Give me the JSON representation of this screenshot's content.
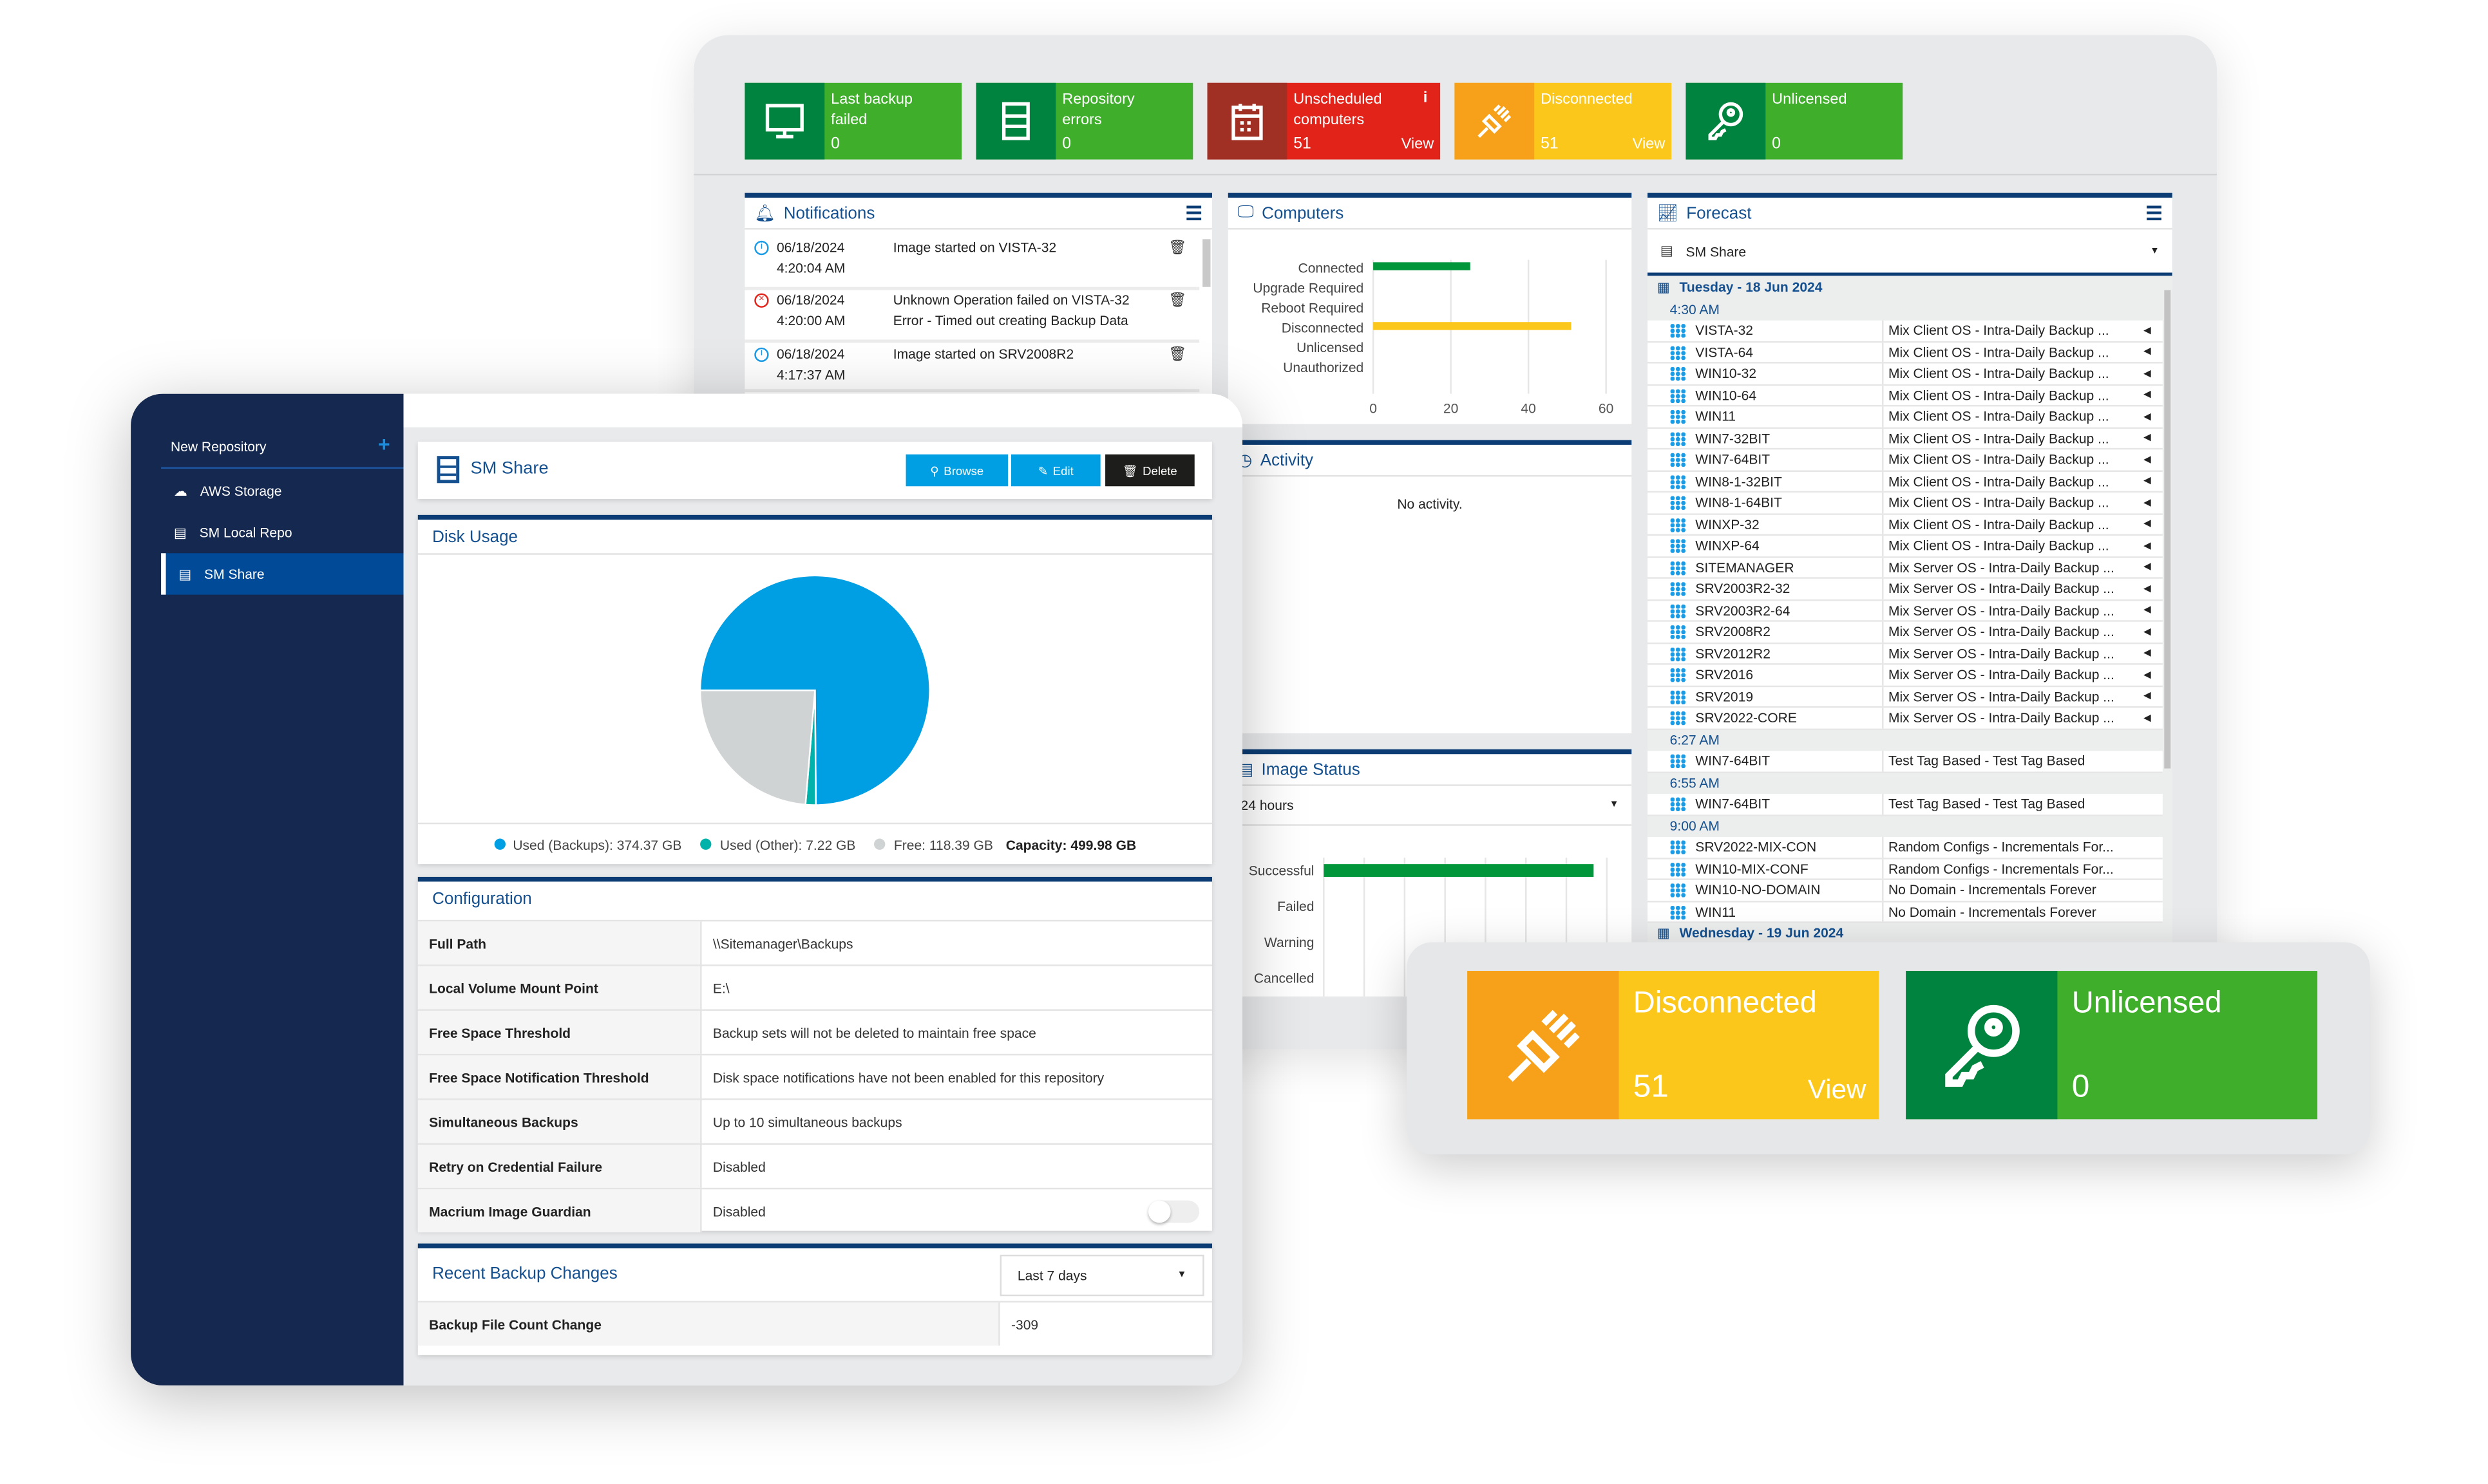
{
  "tiles": [
    {
      "title": "Last backup failed",
      "value": "0",
      "icon": "monitor-icon",
      "dark": "#00833e",
      "light": "#3fae2a"
    },
    {
      "title": "Repository errors",
      "value": "0",
      "icon": "server-icon",
      "dark": "#00833e",
      "light": "#3fae2a"
    },
    {
      "title": "Unscheduled computers",
      "value": "51",
      "view": "View",
      "icon": "calendar-icon",
      "info": "i",
      "dark": "#a03024",
      "light": "#e2231a"
    },
    {
      "title": "Disconnected",
      "value": "51",
      "view": "View",
      "icon": "plug-icon",
      "dark": "#f7a11a",
      "light": "#fbc71b"
    },
    {
      "title": "Unlicensed",
      "value": "0",
      "icon": "key-icon",
      "dark": "#00833e",
      "light": "#3fae2a"
    }
  ],
  "notifications": {
    "title": "Notifications",
    "items": [
      {
        "date": "06/18/2024",
        "time": "4:20:04 AM",
        "text": "Image started on VISTA-32",
        "text2": "",
        "status": "info"
      },
      {
        "date": "06/18/2024",
        "time": "4:20:00 AM",
        "text": "Unknown Operation failed on VISTA-32",
        "text2": "Error - Timed out creating Backup Data",
        "status": "error"
      },
      {
        "date": "06/18/2024",
        "time": "4:17:37 AM",
        "text": "Image started on SRV2008R2",
        "text2": "",
        "status": "info"
      }
    ]
  },
  "computers": {
    "title": "Computers",
    "chart": {
      "type": "bar",
      "orientation": "horizontal",
      "categories": [
        "Connected",
        "Upgrade Required",
        "Reboot Required",
        "Disconnected",
        "Unlicensed",
        "Unauthorized"
      ],
      "values": [
        25,
        0,
        0,
        51,
        0,
        0
      ],
      "colors": [
        "#009639",
        "#009639",
        "#009639",
        "#fbc71b",
        "#009639",
        "#009639"
      ],
      "xlim": [
        0,
        60
      ],
      "ticks": [
        "0",
        "20",
        "40",
        "60"
      ],
      "grid": true
    }
  },
  "activity": {
    "title": "Activity",
    "empty": "No activity."
  },
  "image_status": {
    "title": "Image Status",
    "period": "24 hours",
    "chart": {
      "type": "bar",
      "orientation": "horizontal",
      "categories": [
        "Successful",
        "Failed",
        "Warning",
        "Cancelled"
      ],
      "fill_fraction": [
        0.94,
        0,
        0,
        0
      ],
      "color": "#009639",
      "grid": true
    }
  },
  "forecast": {
    "title": "Forecast",
    "repository": "SM Share",
    "groups": [
      {
        "day": "Tuesday - 18 Jun 2024",
        "time": "4:30 AM",
        "rows": [
          [
            "VISTA-32",
            "Mix Client OS - Intra-Daily Backup ..."
          ],
          [
            "VISTA-64",
            "Mix Client OS - Intra-Daily Backup ..."
          ],
          [
            "WIN10-32",
            "Mix Client OS - Intra-Daily Backup ..."
          ],
          [
            "WIN10-64",
            "Mix Client OS - Intra-Daily Backup ..."
          ],
          [
            "WIN11",
            "Mix Client OS - Intra-Daily Backup ..."
          ],
          [
            "WIN7-32BIT",
            "Mix Client OS - Intra-Daily Backup ..."
          ],
          [
            "WIN7-64BIT",
            "Mix Client OS - Intra-Daily Backup ..."
          ],
          [
            "WIN8-1-32BIT",
            "Mix Client OS - Intra-Daily Backup ..."
          ],
          [
            "WIN8-1-64BIT",
            "Mix Client OS - Intra-Daily Backup ..."
          ],
          [
            "WINXP-32",
            "Mix Client OS - Intra-Daily Backup ..."
          ],
          [
            "WINXP-64",
            "Mix Client OS - Intra-Daily Backup ..."
          ],
          [
            "SITEMANAGER",
            "Mix Server OS - Intra-Daily Backup ..."
          ],
          [
            "SRV2003R2-32",
            "Mix Server OS - Intra-Daily Backup ..."
          ],
          [
            "SRV2003R2-64",
            "Mix Server OS - Intra-Daily Backup ..."
          ],
          [
            "SRV2008R2",
            "Mix Server OS - Intra-Daily Backup ..."
          ],
          [
            "SRV2012R2",
            "Mix Server OS - Intra-Daily Backup ..."
          ],
          [
            "SRV2016",
            "Mix Server OS - Intra-Daily Backup ..."
          ],
          [
            "SRV2019",
            "Mix Server OS - Intra-Daily Backup ..."
          ],
          [
            "SRV2022-CORE",
            "Mix Server OS - Intra-Daily Backup ..."
          ]
        ]
      },
      {
        "time": "6:27 AM",
        "rows": [
          [
            "WIN7-64BIT",
            "Test Tag Based - Test Tag Based"
          ]
        ]
      },
      {
        "time": "6:55 AM",
        "rows": [
          [
            "WIN7-64BIT",
            "Test Tag Based - Test Tag Based"
          ]
        ]
      },
      {
        "time": "9:00 AM",
        "rows": [
          [
            "SRV2022-MIX-CON",
            "Random Configs - Incrementals For..."
          ],
          [
            "WIN10-MIX-CONF",
            "Random Configs - Incrementals For..."
          ],
          [
            "WIN10-NO-DOMAIN",
            "No Domain - Incrementals Forever"
          ],
          [
            "WIN11",
            "No Domain - Incrementals Forever"
          ]
        ]
      },
      {
        "day": "Wednesday - 19 Jun 2024",
        "rows": []
      }
    ]
  },
  "sidebar": {
    "new_label": "New Repository",
    "add": "+",
    "items": [
      {
        "label": "AWS Storage",
        "icon": "cloud-icon"
      },
      {
        "label": "SM Local Repo",
        "icon": "drive-icon"
      },
      {
        "label": "SM Share",
        "icon": "server-icon",
        "active": true
      }
    ]
  },
  "repo": {
    "title": "SM Share",
    "browse": "Browse",
    "edit": "Edit",
    "delete": "Delete"
  },
  "disk": {
    "title": "Disk Usage",
    "slices": [
      {
        "label": "Used (Backups): 374.37 GB",
        "value": 374.37,
        "color": "#009fe3"
      },
      {
        "label": "Used (Other): 7.22 GB",
        "value": 7.22,
        "color": "#00b2a9"
      },
      {
        "label": "Free: 118.39 GB",
        "value": 118.39,
        "color": "#d0d3d4"
      }
    ],
    "capacity": "Capacity: 499.98 GB"
  },
  "config": {
    "title": "Configuration",
    "rows": [
      [
        "Full Path",
        "\\\\Sitemanager\\Backups"
      ],
      [
        "Local Volume Mount Point",
        "E:\\"
      ],
      [
        "Free Space Threshold",
        "Backup sets will not be deleted to maintain free space"
      ],
      [
        "Free Space Notification Threshold",
        "Disk space notifications have not been enabled for this repository"
      ],
      [
        "Simultaneous Backups",
        "Up to 10 simultaneous backups"
      ],
      [
        "Retry on Credential Failure",
        "Disabled"
      ],
      [
        "Macrium Image Guardian",
        "Disabled"
      ]
    ],
    "guardian_on": false
  },
  "recent": {
    "title": "Recent Backup Changes",
    "period": "Last 7 days",
    "rows": [
      [
        "Backup File Count Change",
        "-309"
      ]
    ]
  },
  "popup": [
    {
      "title": "Disconnected",
      "value": "51",
      "view": "View",
      "icon": "plug-icon",
      "dark": "#f7a11a",
      "light": "#fbc71b"
    },
    {
      "title": "Unlicensed",
      "value": "0",
      "icon": "key-icon",
      "dark": "#00833e",
      "light": "#3fae2a"
    }
  ]
}
